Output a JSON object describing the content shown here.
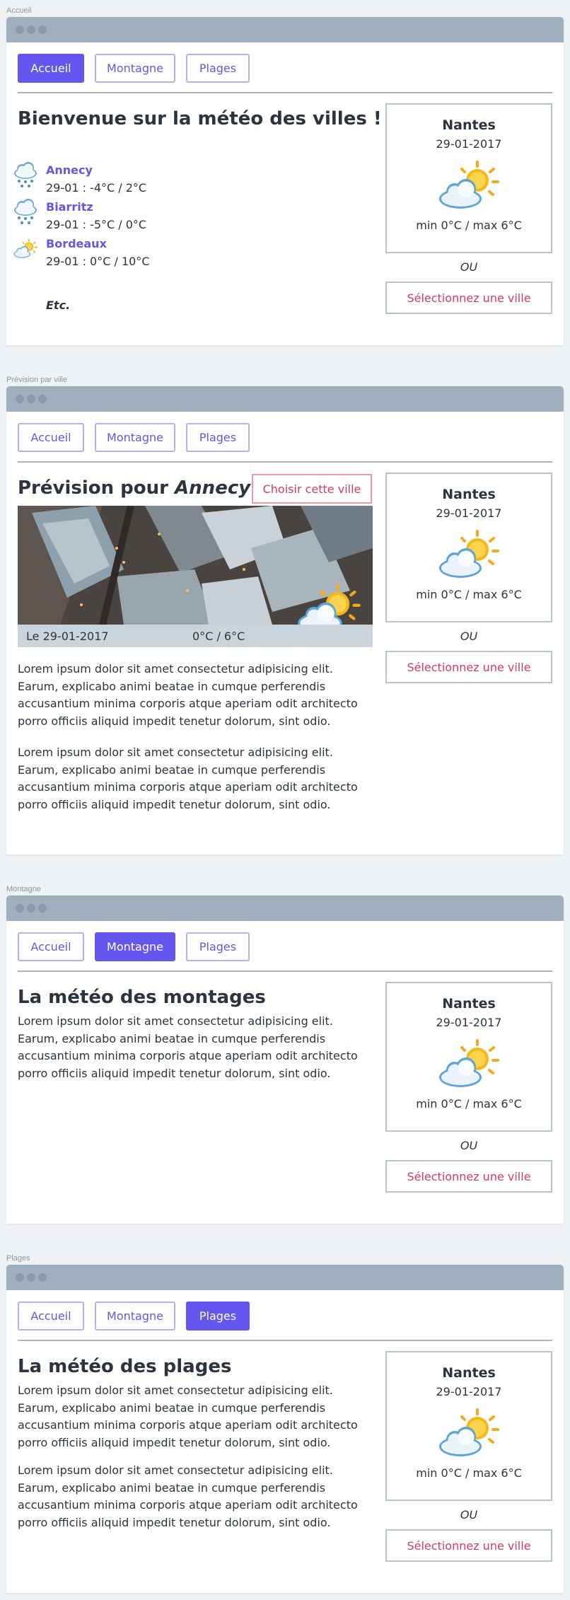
{
  "sections": {
    "accueil": "Accueil",
    "prevision": "Prévision par ville",
    "montagne": "Montagne",
    "plages": "Plages"
  },
  "nav": {
    "accueil": "Accueil",
    "montagne": "Montagne",
    "plages": "Plages"
  },
  "sidebar": {
    "city": "Nantes",
    "date": "29-01-2017",
    "range": "min 0°C / max 6°C",
    "ou": "OU",
    "select": "Sélectionnez une ville",
    "icon": "partly-cloudy-icon"
  },
  "accueil": {
    "title": "Bienvenue sur la météo des villes !",
    "villes": [
      {
        "name": "Annecy",
        "temp": "29-01 : -4°C / 2°C",
        "icon": "snow-icon"
      },
      {
        "name": "Biarritz",
        "temp": "29-01 : -5°C / 0°C",
        "icon": "snow-icon"
      },
      {
        "name": "Bordeaux",
        "temp": "29-01 : 0°C / 10°C",
        "icon": "partly-cloudy-icon"
      }
    ],
    "etc": "Etc."
  },
  "prevision": {
    "title_prefix": "Prévision pour ",
    "title_city": "Annecy",
    "choose": "Choisir cette ville",
    "photo_date": "Le 29-01-2017",
    "photo_temp": "0°C / 6°C",
    "p1": "Lorem ipsum dolor sit amet consectetur adipisicing elit. Earum, explicabo animi beatae in cumque perferendis accusantium minima corporis atque aperiam odit architecto porro officiis aliquid impedit tenetur dolorum, sint odio.",
    "p2": "Lorem ipsum dolor sit amet consectetur adipisicing elit. Earum, explicabo animi beatae in cumque perferendis accusantium minima corporis atque aperiam odit architecto porro officiis aliquid impedit tenetur dolorum, sint odio."
  },
  "montagne": {
    "title": "La météo des montages",
    "p1": "Lorem ipsum dolor sit amet consectetur adipisicing elit. Earum, explicabo animi beatae in cumque perferendis accusantium minima corporis atque aperiam odit architecto porro officiis aliquid impedit tenetur dolorum, sint odio."
  },
  "plages": {
    "title": "La météo des plages",
    "p1": "Lorem ipsum dolor sit amet consectetur adipisicing elit. Earum, explicabo animi beatae in cumque perferendis accusantium minima corporis atque aperiam odit architecto porro officiis aliquid impedit tenetur dolorum, sint odio.",
    "p2": "Lorem ipsum dolor sit amet consectetur adipisicing elit. Earum, explicabo animi beatae in cumque perferendis accusantium minima corporis atque aperiam odit architecto porro officiis aliquid impedit tenetur dolorum, sint odio."
  },
  "colors": {
    "accent": "#6457f0",
    "danger": "#d93a5c",
    "titlebar": "#a0afbe"
  }
}
